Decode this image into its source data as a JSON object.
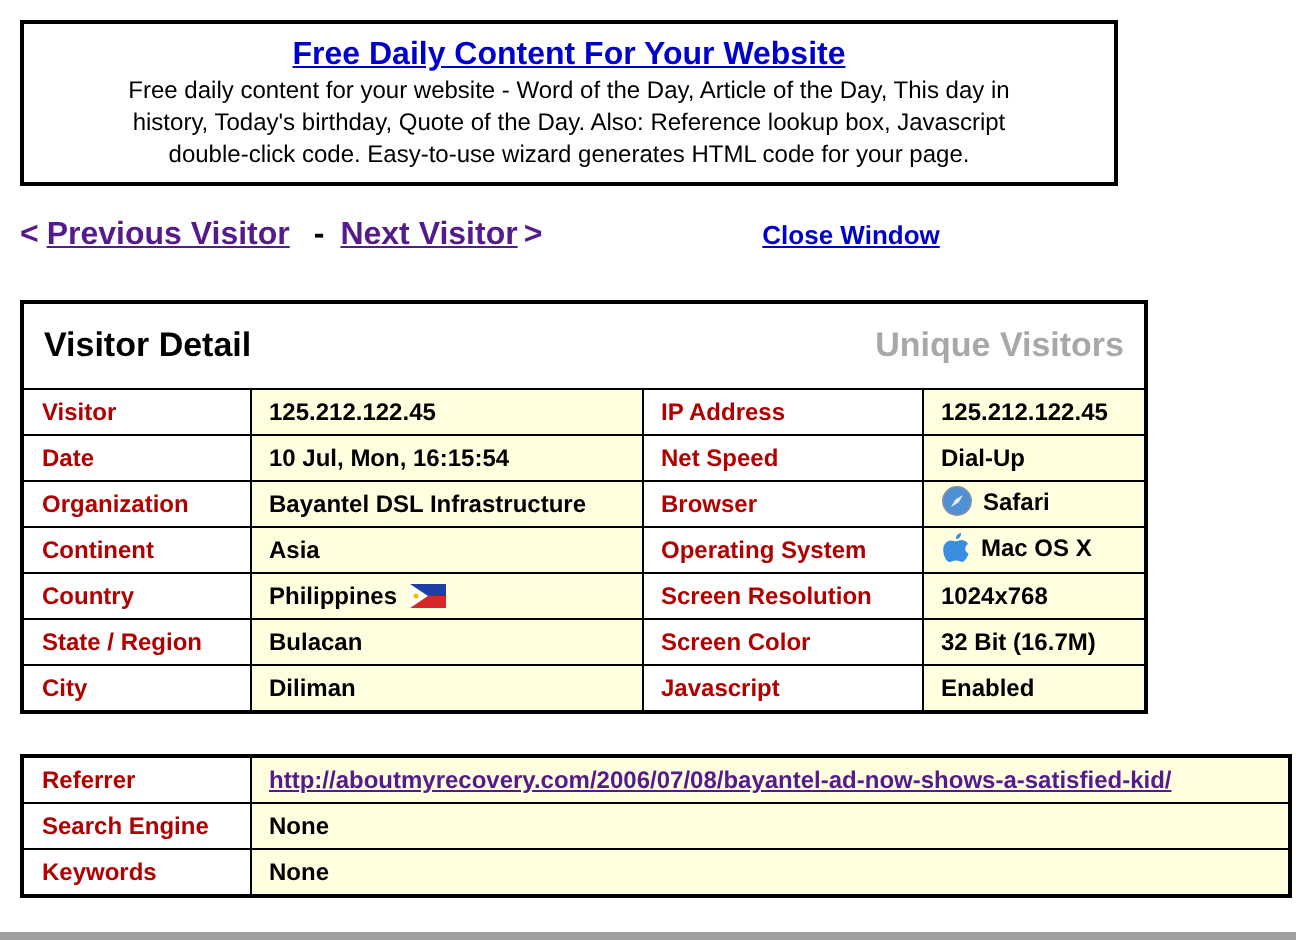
{
  "banner": {
    "title": "Free Daily Content For Your Website",
    "text": "Free daily content for your website - Word of the Day, Article of the Day, This day in history, Today's birthday, Quote of the Day. Also: Reference lookup box, Javascript double-click code. Easy-to-use wizard generates HTML code for your page."
  },
  "nav": {
    "previous": {
      "arrow": "<",
      "label": "Previous Visitor",
      "visited": true
    },
    "separator": "-",
    "next": {
      "label": "Next Visitor",
      "arrow": ">",
      "visited": true
    },
    "close": {
      "label": "Close Window",
      "visited": false
    }
  },
  "visitor_detail": {
    "title": "Visitor Detail",
    "subtitle": "Unique Visitors",
    "rows": [
      {
        "left": {
          "label": "Visitor",
          "value": "125.212.122.45",
          "kind": "text"
        },
        "right": {
          "label": "IP Address",
          "value": "125.212.122.45",
          "kind": "text"
        }
      },
      {
        "left": {
          "label": "Date",
          "value": "10 Jul, Mon, 16:15:54",
          "kind": "text"
        },
        "right": {
          "label": "Net Speed",
          "value": "Dial-Up",
          "kind": "text"
        }
      },
      {
        "left": {
          "label": "Organization",
          "value": "Bayantel DSL Infrastructure",
          "kind": "text"
        },
        "right": {
          "label": "Browser",
          "value": "Safari",
          "kind": "browser"
        }
      },
      {
        "left": {
          "label": "Continent",
          "value": "Asia",
          "kind": "text"
        },
        "right": {
          "label": "Operating System",
          "value": "Mac OS X",
          "kind": "os"
        }
      },
      {
        "left": {
          "label": "Country",
          "value": "Philippines",
          "kind": "flag"
        },
        "right": {
          "label": "Screen Resolution",
          "value": "1024x768",
          "kind": "text"
        }
      },
      {
        "left": {
          "label": "State / Region",
          "value": "Bulacan",
          "kind": "text"
        },
        "right": {
          "label": "Screen Color",
          "value": "32 Bit (16.7M)",
          "kind": "text"
        }
      },
      {
        "left": {
          "label": "City",
          "value": "Diliman",
          "kind": "text"
        },
        "right": {
          "label": "Javascript",
          "value": "Enabled",
          "kind": "text"
        }
      }
    ]
  },
  "referrer_table": {
    "rows": [
      {
        "label": "Referrer",
        "value": "http://aboutmyrecovery.com/2006/07/08/bayantel-ad-now-shows-a-satisfied-kid/",
        "kind": "link",
        "visited": true
      },
      {
        "label": "Search Engine",
        "value": "None",
        "kind": "text"
      },
      {
        "label": "Keywords",
        "value": "None",
        "kind": "text"
      }
    ]
  }
}
